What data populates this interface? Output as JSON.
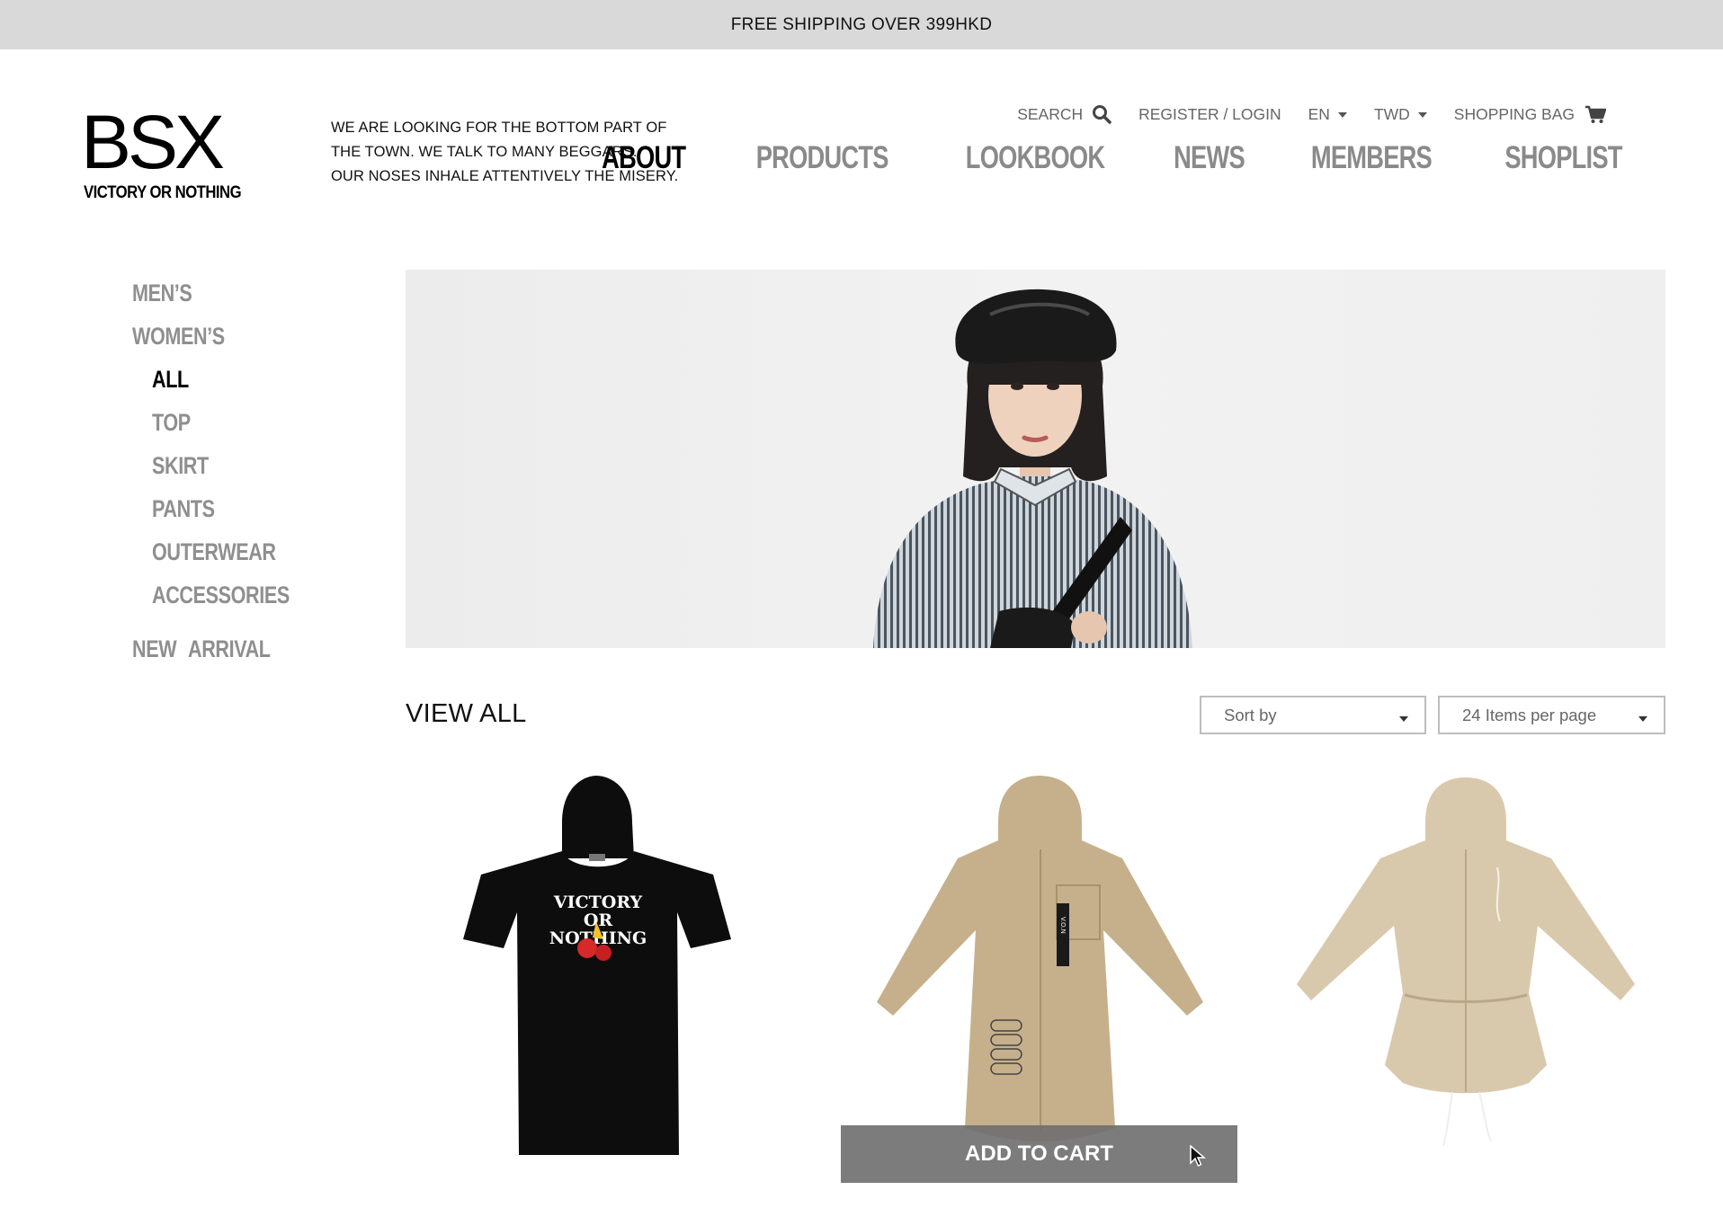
{
  "promo": {
    "text": "FREE SHIPPING OVER 399HKD"
  },
  "brand": {
    "logo": "BSX",
    "tagline_sub": "VICTORY OR NOTHING"
  },
  "tagline": [
    "WE ARE LOOKING FOR THE BOTTOM PART OF",
    "THE TOWN. WE TALK TO MANY BEGGARS.",
    "OUR NOSES INHALE ATTENTIVELY THE MISERY."
  ],
  "util_nav": {
    "search": "SEARCH",
    "login": "REGISTER / LOGIN",
    "language": "EN",
    "currency": "TWD",
    "bag": "SHOPPING BAG"
  },
  "main_nav": [
    "ABOUT",
    "PRODUCTS",
    "LOOKBOOK",
    "NEWS",
    "MEMBERS",
    "SHOPLIST"
  ],
  "side_nav": {
    "mens": "MEN’S",
    "womens": "WOMEN’S",
    "subs": [
      "ALL",
      "TOP",
      "SKIRT",
      "PANTS",
      "OUTERWEAR",
      "ACCESSORIES"
    ],
    "new_arrival": "NEW ARRIVAL"
  },
  "listing": {
    "heading": "VIEW ALL",
    "sort_label": "Sort by",
    "per_page_label": "24 Items per page",
    "add_to_cart": "ADD TO CART"
  },
  "products": [
    {
      "graphic_text": [
        "VICTORY",
        "OR",
        "NOTHING"
      ]
    },
    {
      "strip_text": "V.O.N"
    },
    {}
  ],
  "colors": {
    "promo_bg": "#d9d9d9",
    "nav_active": "#000000",
    "nav_inactive": "#8a8a8a",
    "overlay": "#6e6e6e"
  }
}
